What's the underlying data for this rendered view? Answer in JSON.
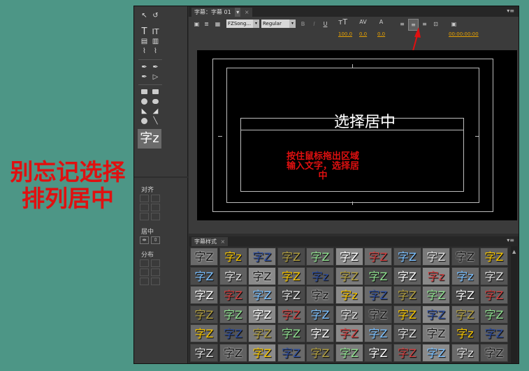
{
  "annotation": {
    "line1": "别忘记选择",
    "line2": "排列居中"
  },
  "tools": {
    "text_tool": "T",
    "vertical_text_tool": "IT",
    "preview_glyph": "字z"
  },
  "align_panel": {
    "align_label": "对齐",
    "center_label": "居中",
    "distribute_label": "分布"
  },
  "titler": {
    "tab_label": "字幕：字幕 01",
    "font_family": "FZSong...",
    "font_style": "Regular",
    "metrics": [
      "100.0",
      "0.0",
      "0.0"
    ],
    "timecode": "00:00:00:00",
    "canvas_title": "选择居中",
    "canvas_note": [
      "按住鼠标拖出区域",
      "输入文字，选择居",
      "中"
    ]
  },
  "styles_panel": {
    "tab_label": "字幕样式",
    "cells": [
      [
        "字Z",
        "字z",
        "字Z",
        "字Z",
        "字Z",
        "字Z",
        "字Z",
        "字Z",
        "字Z",
        "字Z",
        "字Z"
      ],
      [
        "字Z",
        "字z",
        "字Z",
        "字Z",
        "字z",
        "字Z",
        "字Z",
        "字Z",
        "字z",
        "字z",
        "字Z"
      ],
      [
        "字Z",
        "字Z",
        "字Z",
        "字Z",
        "字z",
        "字z",
        "字Z",
        "字Z",
        "字Z",
        "字Z",
        "字Z"
      ],
      [
        "字Z",
        "字Z",
        "字Z",
        "字Z",
        "字Z",
        "字z",
        "字Z",
        "字Z",
        "字Z",
        "字Z",
        "字Z"
      ],
      [
        "字Z",
        "字Z",
        "字Z",
        "字Z",
        "字Z",
        "字Z",
        "字Z",
        "字Z",
        "字Z",
        "字z",
        "字Z"
      ],
      [
        "字Z",
        "字Z",
        "字Z",
        "字Z",
        "字Z",
        "字Z",
        "字Z",
        "字Z",
        "字Z",
        "字z",
        "字Z"
      ]
    ],
    "colors": [
      "#111111",
      "#ffffff",
      "#f5c400",
      "#d04040",
      "#2f4f9f",
      "#7cc0ff",
      "#b3a040",
      "#e0e0e0",
      "#90e090"
    ]
  }
}
